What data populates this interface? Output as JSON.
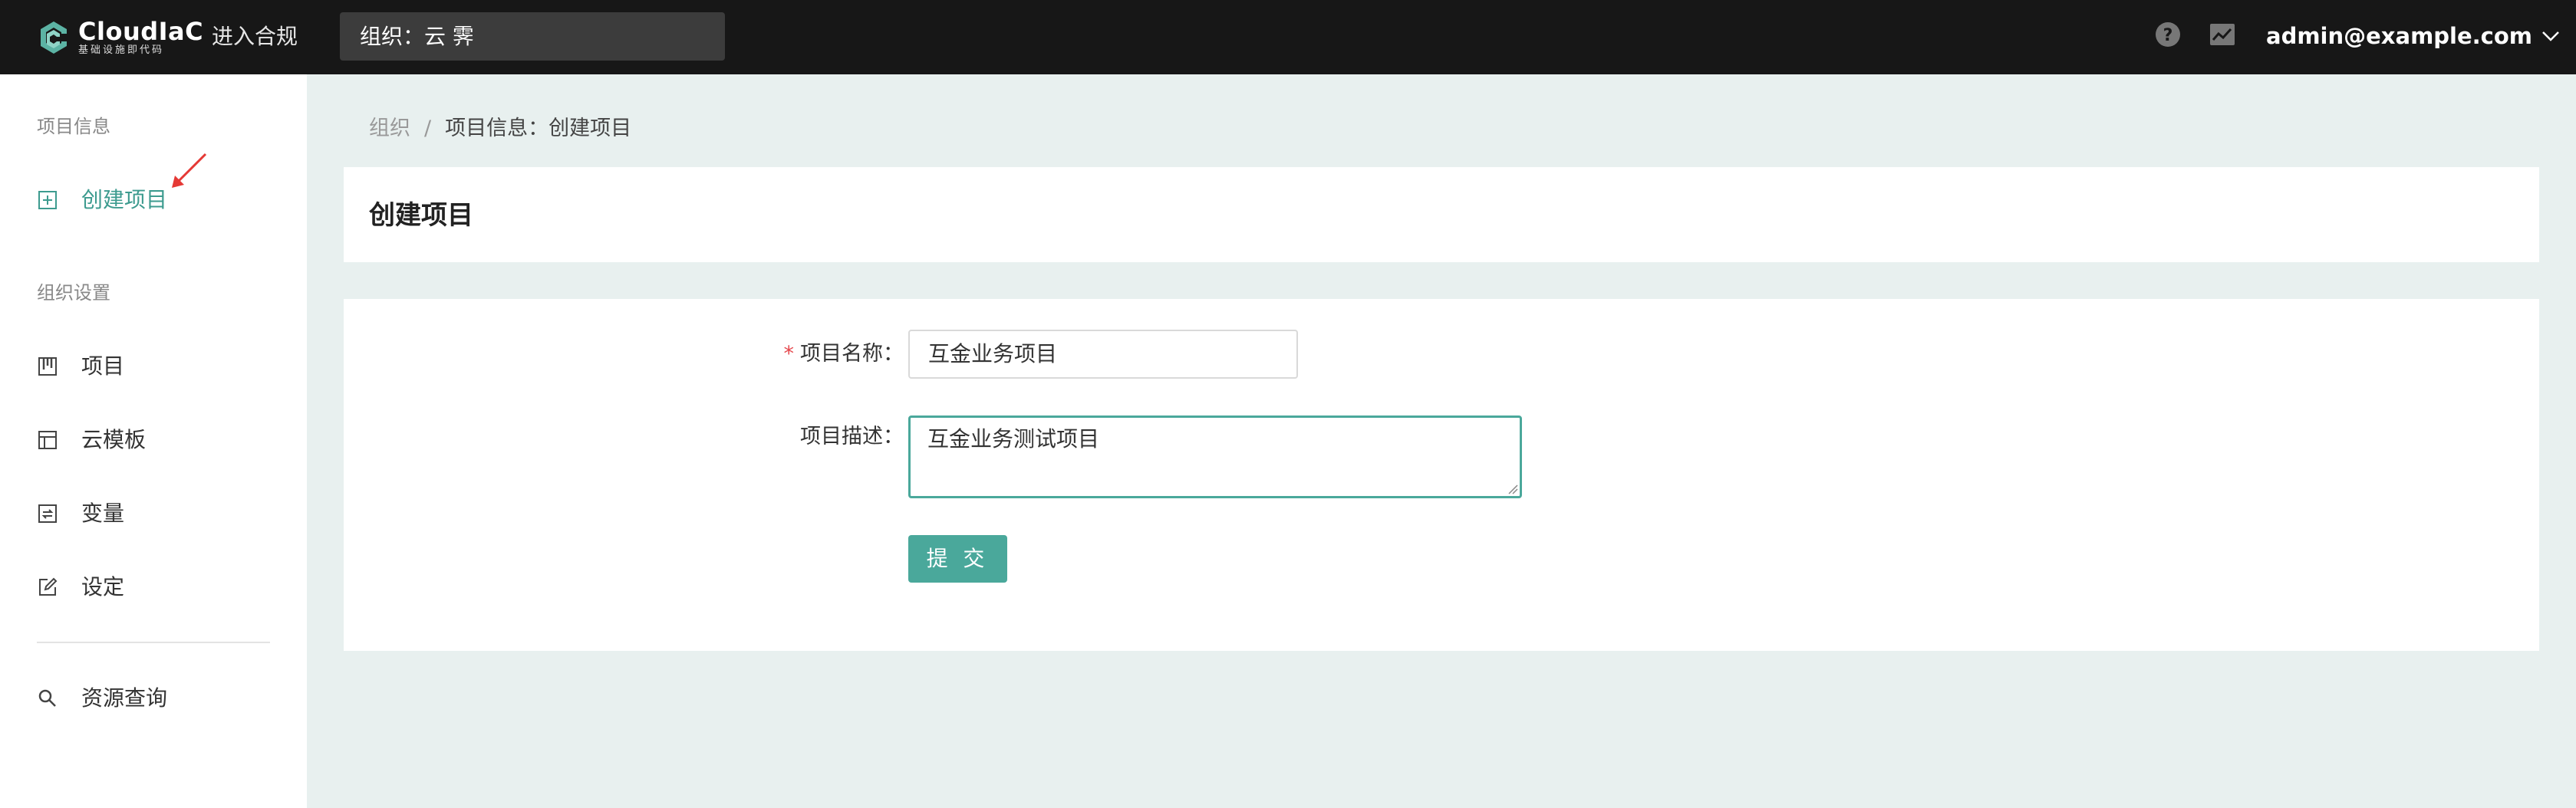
{
  "header": {
    "logo_title": "CloudIaC",
    "logo_subtitle": "基础设施即代码",
    "enter_compliance": "进入合规",
    "org_selector": "组织：云 霁",
    "user": "admin@example.com",
    "accent_color": "#3d9b8f"
  },
  "sidebar": {
    "group1_title": "项目信息",
    "create_project": "创建项目",
    "group2_title": "组织设置",
    "items": [
      {
        "label": "项目",
        "icon": "project-icon"
      },
      {
        "label": "云模板",
        "icon": "template-icon"
      },
      {
        "label": "变量",
        "icon": "variable-icon"
      },
      {
        "label": "设定",
        "icon": "edit-icon"
      }
    ],
    "resource_query": "资源查询"
  },
  "breadcrumb": {
    "root": "组织",
    "separator": "/",
    "current": "项目信息：创建项目"
  },
  "page_title": "创建项目",
  "form": {
    "name_label": "项目名称：",
    "name_value": "互金业务项目",
    "desc_label": "项目描述：",
    "desc_value": "互金业务测试项目",
    "submit": "提 交"
  }
}
